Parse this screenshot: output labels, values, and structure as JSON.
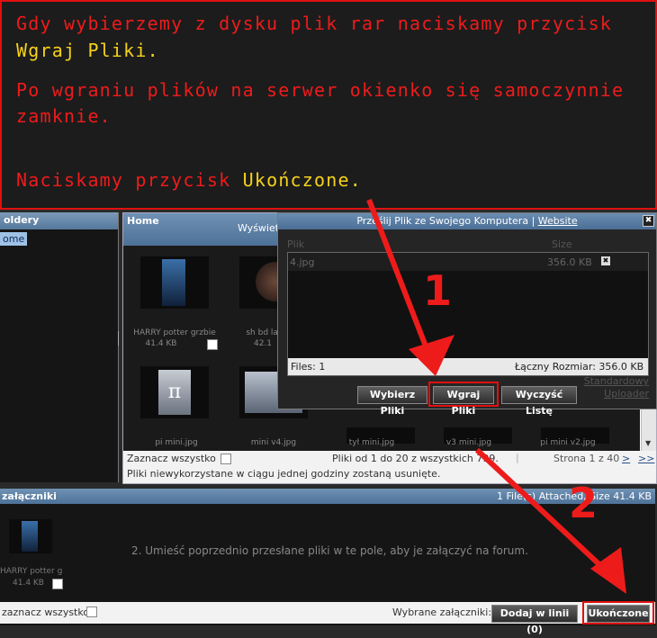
{
  "banner": {
    "line1": "Gdy wybierzemy z dysku plik rar naciskamy przycisk",
    "line2_highlight": "Wgraj Pliki",
    "line2_end": ".",
    "line3": "Po wgraniu plików na serwer okienko się samoczynnie",
    "line4": "zamknie.",
    "line5_start": "Naciskamy przycisk ",
    "line5_highlight": "Ukończone",
    "line5_end": "."
  },
  "folders": {
    "title": "oldery",
    "item": "ome"
  },
  "home": {
    "title": "Home",
    "subtitle": "Wyświet",
    "thumbnails": [
      {
        "caption": "HARRY potter grzbie",
        "size": "41.4 KB"
      },
      {
        "caption": "sh bd lab",
        "size": "42.1"
      },
      {
        "caption": "pi mini.jpg",
        "size": ""
      },
      {
        "caption": "mini v4.jpg",
        "size": ""
      },
      {
        "caption": "tył mini.jpg",
        "size": ""
      },
      {
        "caption": "v3 mini.jpg",
        "size": ""
      },
      {
        "caption": "pi mini v2.jpg",
        "size": ""
      }
    ],
    "select_all": "Zaznacz wszystko",
    "pagination_info": "Pliki od 1 do 20 z wszystkich 799.",
    "page_info": "Strona 1 z 40",
    "next": ">",
    "last": ">>",
    "note": "Pliki niewykorzystane w ciągu jednej godziny zostaną usunięte."
  },
  "dialog": {
    "title": "Prześlij Plik ze Swojego Komputera",
    "separator": "|",
    "website_link": "Website",
    "close": "✖",
    "col_file": "Plik",
    "col_size": "Size",
    "file_name": "4.jpg",
    "file_size": "356.0 KB",
    "remove": "✖",
    "files_count": "Files: 1",
    "total_size": "Łączny Rozmiar: 356.0 KB",
    "btn_choose": "Wybierz Pliki",
    "btn_upload": "Wgraj Pliki",
    "btn_clear": "Wyczyść Listę",
    "standard_uploader": "Standardowy Uploader"
  },
  "attachments": {
    "title": "załączniki",
    "attached_info": "1 File(s) Attached, Size 41.4 KB",
    "thumb_caption": "HARRY potter g",
    "thumb_size": "41.4 KB",
    "hint": "2. Umieść poprzednio przesłane pliki w te pole, aby je załączyć na forum.",
    "select_all": "zaznacz wszystko",
    "selected_label": "Wybrane załączniki:",
    "add_inline": "Dodaj w linii (0)",
    "finish": "Ukończone"
  },
  "annotations": {
    "num1": "1",
    "num2": "2"
  },
  "colors": {
    "annotation_red": "#e01010",
    "highlight_yellow": "#f6d21a",
    "header_blue": "#55789c"
  }
}
